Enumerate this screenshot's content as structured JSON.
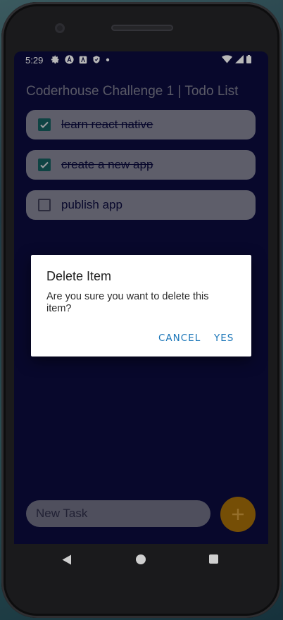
{
  "status_bar": {
    "time": "5:29",
    "left_icons": [
      "gear-icon",
      "app-a-icon",
      "app-square-icon",
      "shield-icon",
      "dot-icon"
    ],
    "right_icons": [
      "wifi-icon",
      "cellular-icon",
      "battery-icon"
    ]
  },
  "app": {
    "title": "Coderhouse Challenge 1 | Todo List"
  },
  "tasks": [
    {
      "label": "learn react native",
      "done": true
    },
    {
      "label": "create a new app",
      "done": true
    },
    {
      "label": "publish app",
      "done": false
    }
  ],
  "dialog": {
    "title": "Delete Item",
    "message": "Are you sure you want to delete this item?",
    "cancel_label": "CANCEL",
    "confirm_label": "YES"
  },
  "new_task": {
    "placeholder": "New Task",
    "value": ""
  },
  "add_button_icon": "plus-icon",
  "colors": {
    "screen_background": "#0c0c3d",
    "task_background": "#838394",
    "checkbox_checked": "#145e5e",
    "fab": "#a36d09",
    "dialog_button": "#1b76b8"
  }
}
